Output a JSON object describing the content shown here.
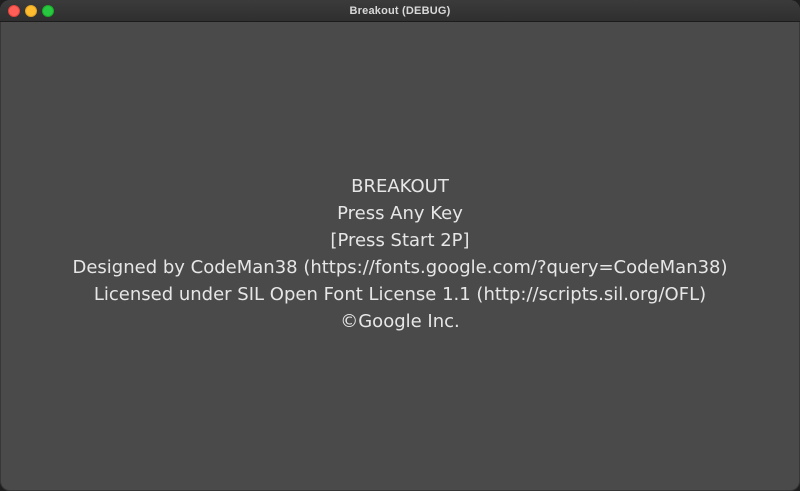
{
  "window": {
    "title": "Breakout (DEBUG)"
  },
  "screen": {
    "lines": [
      "BREAKOUT",
      "Press Any Key",
      "[Press Start 2P]",
      "Designed by CodeMan38 (https://fonts.google.com/?query=CodeMan38)",
      "Licensed under SIL Open Font License 1.1 (http://scripts.sil.org/OFL)",
      "©Google Inc."
    ]
  },
  "colors": {
    "background": "#4a4a4a",
    "text": "#e6e6e6",
    "close": "#ff5f57",
    "minimize": "#febc2e",
    "maximize": "#28c840"
  }
}
